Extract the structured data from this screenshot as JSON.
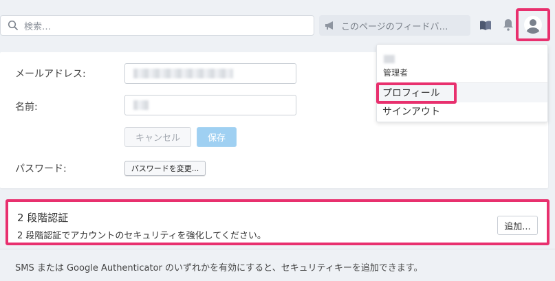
{
  "search": {
    "placeholder": "検索…"
  },
  "feedback": {
    "label": "このページのフィードバ…"
  },
  "icons": {
    "search": "search-icon",
    "feedback": "megaphone-icon",
    "docs": "book-icon",
    "notifications": "bell-icon",
    "avatar": "user-avatar-icon"
  },
  "accent_color": "#e8306e",
  "account_form": {
    "email_label": "メールアドレス:",
    "name_label": "名前:",
    "cancel_label": "キャンセル",
    "save_label": "保存",
    "password_label": "パスワード:",
    "change_password_label": "パスワードを変更..."
  },
  "user_menu": {
    "role": "管理者",
    "items": [
      "プロフィール",
      "サインアウト"
    ]
  },
  "two_factor": {
    "title": "2 段階認証",
    "description": "2 段階認証でアカウントのセキュリティを強化してください。",
    "add_label": "追加..."
  },
  "note": "SMS または Google Authenticator のいずれかを有効にすると、セキュリティキーを追加できます。"
}
